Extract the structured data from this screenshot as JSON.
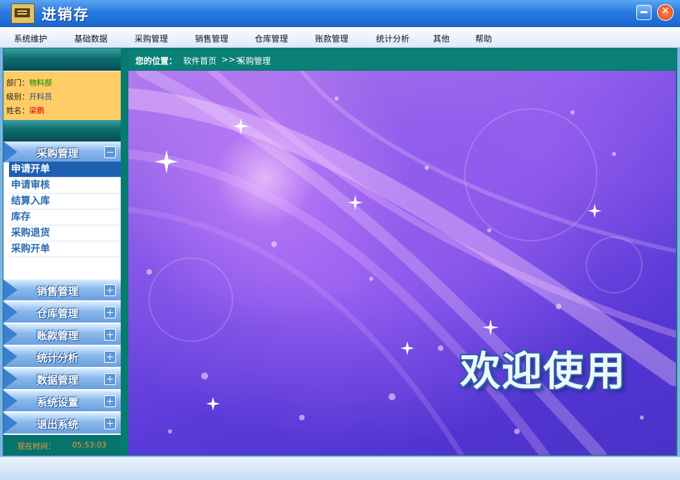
{
  "window": {
    "title": "进销存"
  },
  "menu": [
    "系统维护",
    "基础数据",
    "采购管理",
    "销售管理",
    "仓库管理",
    "账款管理",
    "统计分析",
    "其他",
    "帮助"
  ],
  "user": {
    "dept_label": "部门：",
    "dept_value": "物料部",
    "level_label": "级别：",
    "level_value": "开料员",
    "name_label": "姓名：",
    "name_value": "梁鹏"
  },
  "nav": {
    "active_section": "采购管理",
    "sub_items": [
      "申请开单",
      "申请审核",
      "结算入库",
      "库存",
      "采购退货",
      "采购开单"
    ],
    "sections": [
      "销售管理",
      "仓库管理",
      "账款管理",
      "统计分析",
      "数据管理",
      "系统设置",
      "退出系统"
    ]
  },
  "clock": {
    "label": "现在时间：",
    "time": "05:53:03"
  },
  "breadcrumb": {
    "label": "您的位置：",
    "home": "软件首页",
    "sep": ">>>",
    "current": "采购管理"
  },
  "banner": {
    "welcome_text": "欢迎使用"
  },
  "colors": {
    "title_bar": "#2a7be0",
    "sidebar_teal": "#0a8176",
    "user_panel": "#ffcc66",
    "banner_purple": "#6a44dc"
  }
}
